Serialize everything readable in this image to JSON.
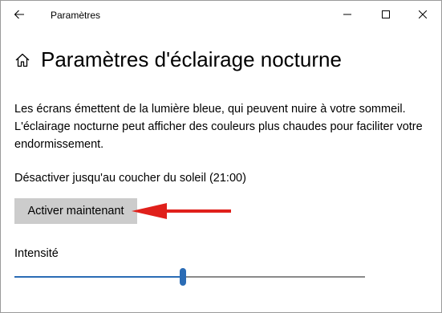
{
  "window": {
    "title": "Paramètres"
  },
  "icons": {
    "back": "back-arrow-icon",
    "minimize": "minimize-icon",
    "maximize": "maximize-icon",
    "close": "close-icon",
    "home": "home-icon"
  },
  "page": {
    "title": "Paramètres d'éclairage nocturne",
    "description": "Les écrans émettent de la lumière bleue, qui peuvent nuire à votre sommeil. L'éclairage nocturne peut afficher des couleurs plus chaudes pour faciliter votre endormissement.",
    "status": "Désactiver jusqu'au coucher du soleil (21:00)",
    "activate_button": "Activer maintenant",
    "intensity_label": "Intensité"
  },
  "intensity": {
    "value_fraction": 0.48
  },
  "colors": {
    "accent": "#2b6cb5",
    "annotation_arrow": "#e0201b",
    "button_bg": "#cccccc"
  }
}
